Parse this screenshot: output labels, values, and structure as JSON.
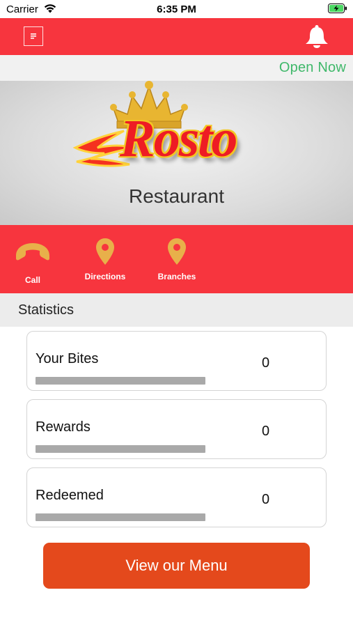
{
  "status_bar": {
    "carrier": "Carrier",
    "time": "6:35 PM"
  },
  "header": {
    "menu_icon": "menu-icon",
    "bell_icon": "bell-icon"
  },
  "open_status": "Open Now",
  "banner": {
    "logo_text": "Rosto",
    "logo_subtitle": "Restaurant"
  },
  "actions": [
    {
      "label": "Call",
      "icon": "phone-icon"
    },
    {
      "label": "Directions",
      "icon": "map-pin-icon"
    },
    {
      "label": "Branches",
      "icon": "map-pin-icon"
    }
  ],
  "statistics": {
    "title": "Statistics",
    "cards": [
      {
        "label": "Your Bites",
        "value": "0"
      },
      {
        "label": "Rewards",
        "value": "0"
      },
      {
        "label": "Redeemed",
        "value": "0"
      }
    ]
  },
  "cta": {
    "label": "View our Menu"
  },
  "colors": {
    "brand_red": "#f7353e",
    "open_green": "#3fb86a",
    "action_icon_gold": "#e8b04a",
    "cta_orange": "#e4491c"
  }
}
